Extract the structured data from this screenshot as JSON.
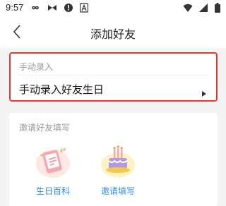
{
  "status_bar": {
    "time": "9:57",
    "left_icons": [
      "infinity-icon",
      "bowtie-icon",
      "alert-circle-icon",
      "a-badge-icon"
    ],
    "right_icons": [
      "wifi-icon",
      "signal-icon",
      "battery-icon"
    ]
  },
  "nav": {
    "title": "添加好友",
    "back_icon": "chevron-left-icon"
  },
  "manual_card": {
    "header": "手动录入",
    "row_label": "手动录入好友生日",
    "arrow_icon": "caret-right-icon",
    "highlight_color": "#e53935"
  },
  "invite_section": {
    "header": "邀请好友填写",
    "tiles": [
      {
        "label": "生日百科",
        "icon": "birthday-card-icon"
      },
      {
        "label": "邀请填写",
        "icon": "birthday-cake-icon"
      }
    ],
    "label_color": "#2d8cf0"
  }
}
